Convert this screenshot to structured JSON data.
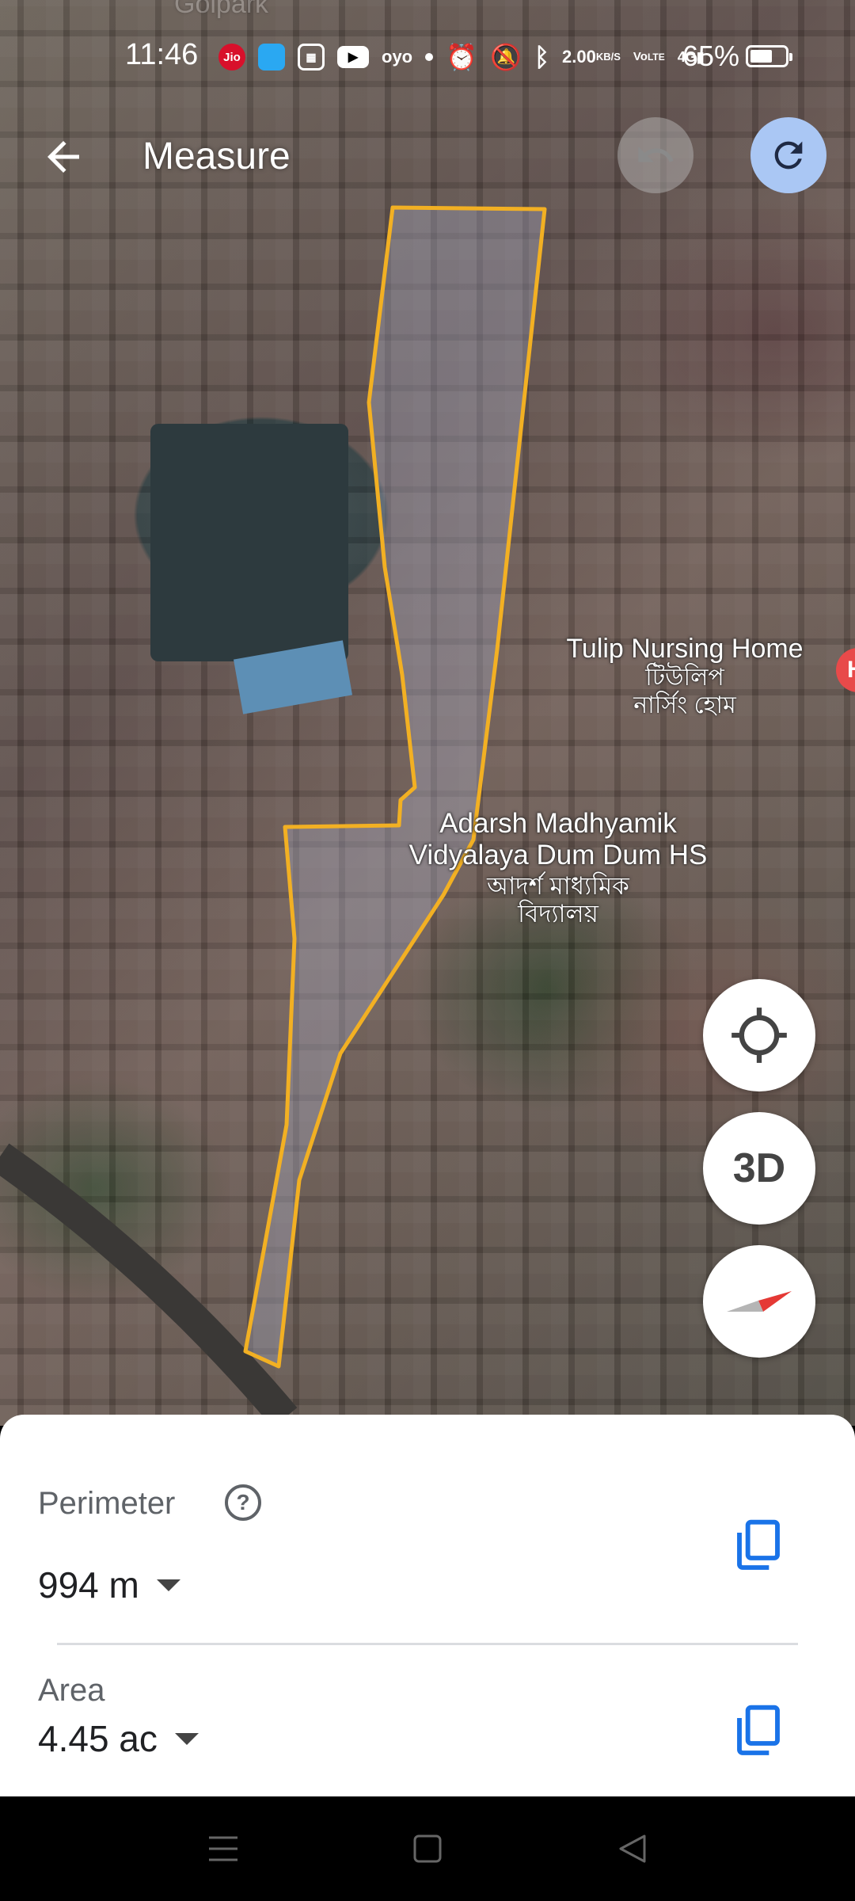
{
  "status_bar": {
    "time": "11:46",
    "jio_label": "Jio",
    "oyo_label": "oyo",
    "net_speed_value": "2.00",
    "net_speed_unit": "KB/S",
    "volte_top": "Vo",
    "volte_bottom": "LTE",
    "signal_label": "4G",
    "battery_percent": "65%",
    "battery_level": 0.65
  },
  "header": {
    "title": "Measure"
  },
  "map": {
    "labels": {
      "tulip_en": "Tulip Nursing Home",
      "tulip_bn_1": "টিউলিপ",
      "tulip_bn_2": "নার্সিং হোম",
      "school_en_1": "Adarsh Madhyamik",
      "school_en_2": "Vidyalaya Dum Dum HS",
      "school_bn_1": "আদর্শ মাধ্যমিক",
      "school_bn_2": "বিদ্যালয়",
      "hospital_pin": "H",
      "top_faded": "Golpark"
    },
    "outline_color": "#f2b023",
    "fab_3d_label": "3D"
  },
  "measure": {
    "perimeter_label": "Perimeter",
    "help_symbol": "?",
    "perimeter_value": "994 m",
    "area_label": "Area",
    "area_value": "4.45 ac"
  },
  "colors": {
    "accent": "#1a73e8",
    "redo_bg": "#aac7f4"
  }
}
